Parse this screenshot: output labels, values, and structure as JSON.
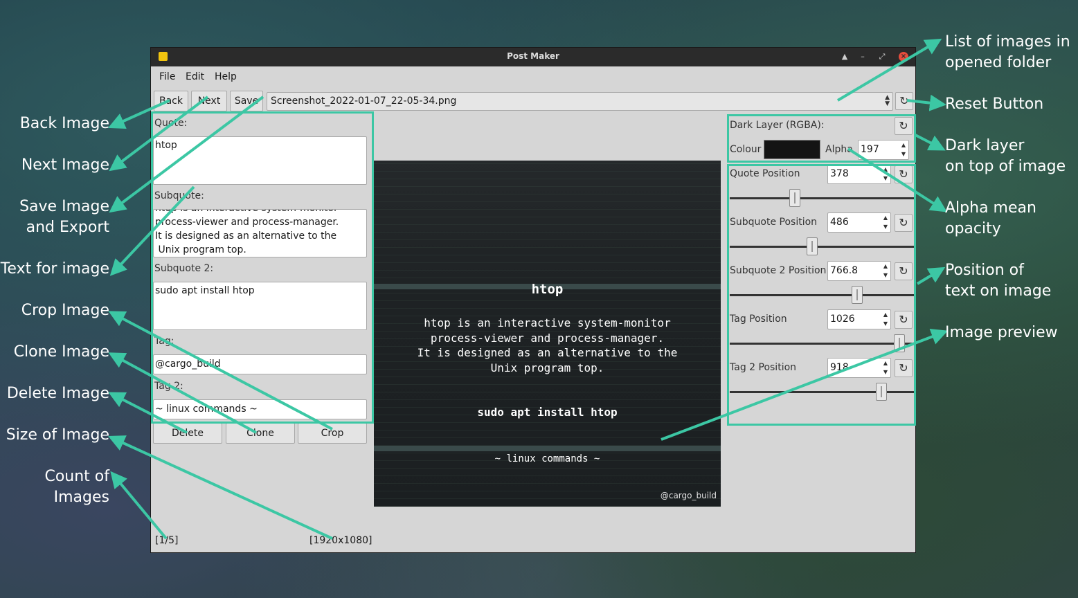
{
  "window": {
    "title": "Post Maker",
    "menu": [
      "File",
      "Edit",
      "Help"
    ]
  },
  "toolbar": {
    "back_label": "Back",
    "next_label": "Next",
    "save_label": "Save",
    "file_selected": "Screenshot_2022-01-07_22-05-34.png"
  },
  "left": {
    "quote_label": "Quote:",
    "quote_value": "htop",
    "subquote_label": "Subquote:",
    "subquote_value": "htop is an interactive system-monitor\nprocess-viewer and process-manager.\nIt is designed as an alternative to the\n Unix program top.",
    "subquote2_label": "Subquote 2:",
    "subquote2_value": "sudo apt install htop",
    "tag_label": "Tag:",
    "tag_value": "@cargo_build",
    "tag2_label": "Tag 2:",
    "tag2_value": "~ linux commands ~",
    "delete_label": "Delete",
    "clone_label": "Clone",
    "crop_label": "Crop"
  },
  "right": {
    "dark_layer_label": "Dark Layer (RGBA):",
    "colour_label": "Colour",
    "colour_value": "#141414",
    "alpha_label": "Alpha",
    "alpha_value": "197",
    "quote_pos_label": "Quote Position",
    "quote_pos_value": "378",
    "subquote_pos_label": "Subquote Position",
    "subquote_pos_value": "486",
    "subquote2_pos_label": "Subquote 2 Position",
    "subquote2_pos_value": "766.8",
    "tag_pos_label": "Tag Position",
    "tag_pos_value": "1026",
    "tag2_pos_label": "Tag 2 Position",
    "tag2_pos_value": "918"
  },
  "preview": {
    "quote": "htop",
    "subquote": "htop is an interactive system-monitor\nprocess-viewer and process-manager.\nIt is designed as an alternative to the\nUnix program top.",
    "subquote2": "sudo apt install htop",
    "tag2": "~ linux commands ~",
    "tag": "@cargo_build"
  },
  "status": {
    "count": "[1/5]",
    "size": "[1920x1080]"
  },
  "annotations": {
    "back": "Back Image",
    "next": "Next Image",
    "save_line1": "Save Image",
    "save_line2": "and Export",
    "text": "Text for image",
    "crop": "Crop Image",
    "clone": "Clone Image",
    "delete": "Delete Image",
    "size": "Size of Image",
    "count_line1": "Count of",
    "count_line2": "Images",
    "list_line1": "List of images in",
    "list_line2": "opened folder",
    "reset": "Reset Button",
    "dark_line1": "Dark layer",
    "dark_line2": "on top of image",
    "alpha_line1": "Alpha mean",
    "alpha_line2": "opacity",
    "position_line1": "Position of",
    "position_line2": "text on image",
    "preview": "Image preview"
  },
  "colors": {
    "annotation_arrow": "#3cc7a4",
    "window_bg": "#d6d6d6",
    "titlebar": "#2b2b2b"
  }
}
